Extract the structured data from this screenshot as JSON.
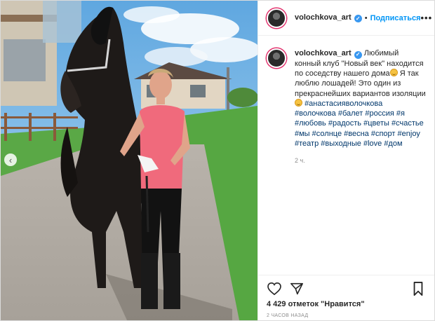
{
  "post": {
    "username": "volochkova_art",
    "follow_label": "Подписаться",
    "separator": "•",
    "more_label": "•••",
    "caption_text": "Любимый конный клуб \"Новый век\" находится по соседству нашего дома",
    "caption_text2": "Я так люблю лошадей! Это один из прекраснейших вариантов изоляции",
    "hashtags": [
      "#анастасияволочкова",
      "#волочкова",
      "#балет",
      "#россия",
      "#я",
      "#любовь",
      "#радость",
      "#цветы",
      "#счастье",
      "#мы",
      "#солнце",
      "#весна",
      "#спорт",
      "#enjoy",
      "#театр",
      "#выходные",
      "#love",
      "#дом"
    ],
    "time_short": "2 ч.",
    "likes": "4 429 отметок \"Нравится\"",
    "time_long": "2 ЧАСОВ НАЗАД"
  },
  "media": {
    "prev_label": "‹"
  },
  "icons": {
    "avatar": "profile-photo",
    "verified": "verified-check-icon",
    "like": "heart-icon",
    "share": "paper-plane-icon",
    "save": "bookmark-icon",
    "emoji": "smiling-face-emoji"
  },
  "colors": {
    "accent": "#0095f6",
    "verified": "#3897f0",
    "hashtag": "#00376b",
    "muted": "#8e8e8e"
  }
}
